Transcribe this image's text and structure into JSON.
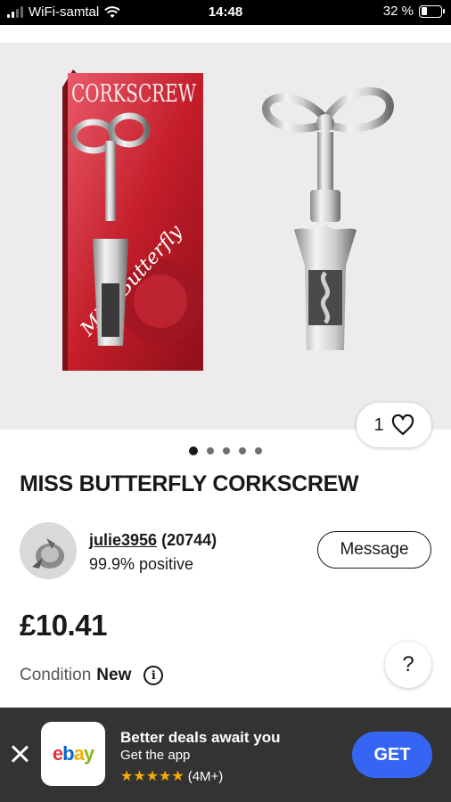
{
  "status_bar": {
    "carrier": "WiFi-samtal",
    "time": "14:48",
    "battery_percent": "32 %",
    "battery_level": 0.32
  },
  "gallery": {
    "box_text_top": "CORKSCREW",
    "box_text_script": "Miss Butterfly",
    "favorite_count": "1",
    "dots_total": 5,
    "active_dot": 0
  },
  "listing": {
    "title": "MISS BUTTERFLY CORKSCREW",
    "price": "£10.41",
    "condition_label": "Condition",
    "condition_value": "New"
  },
  "seller": {
    "name": "julie3956",
    "feedback_count": "(20744)",
    "positive": "99.9% positive",
    "message_label": "Message"
  },
  "help": {
    "label": "?"
  },
  "app_banner": {
    "logo_letters": [
      "e",
      "b",
      "a",
      "y"
    ],
    "headline": "Better deals await you",
    "subtitle": "Get the app",
    "stars": "★★★★★",
    "rating_count": "(4M+)",
    "get_label": "GET"
  },
  "colors": {
    "accent_blue": "#3665f3",
    "banner_bg": "#333333",
    "gallery_bg": "#ececec",
    "star_color": "#f5af02"
  }
}
